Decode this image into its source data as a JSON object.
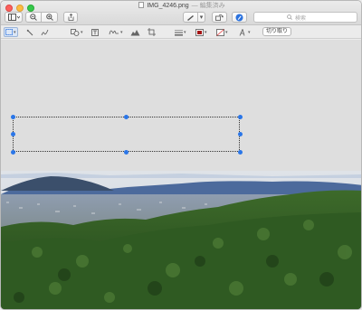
{
  "window": {
    "filename": "IMG_4246.png",
    "status": "— 編集済み"
  },
  "toolbar": {
    "search_placeholder": "検索"
  },
  "markup": {
    "crop_label": "切り取り"
  },
  "colors": {
    "selection_handle": "#2a76e8",
    "border_color_swatch": "#a31515",
    "close": "#fc605c",
    "minimize": "#fdbc40",
    "maximize": "#34c84a"
  },
  "icons": [
    "sidebar-icon",
    "zoom-out-icon",
    "zoom-in-icon",
    "share-icon",
    "pen-icon",
    "rotate-icon",
    "markup-icon",
    "selection-rect-icon",
    "instant-alpha-icon",
    "sketch-icon",
    "shapes-icon",
    "text-icon",
    "signature-icon",
    "adjust-color-icon",
    "crop-icon",
    "line-style-icon",
    "border-color-icon",
    "fill-color-icon",
    "text-style-icon"
  ]
}
